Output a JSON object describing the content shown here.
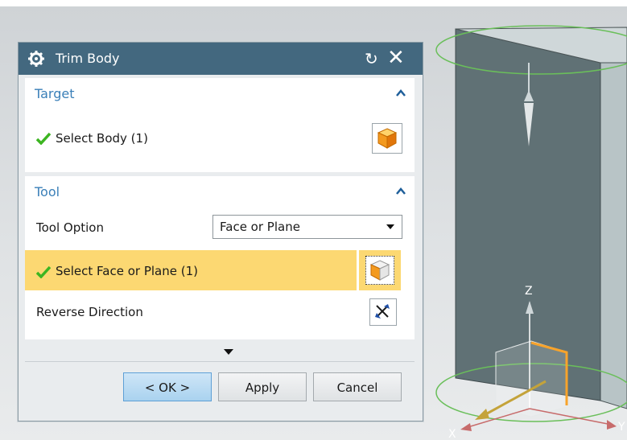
{
  "dialog": {
    "title": "Trim Body",
    "icons": {
      "title": "gear-icon",
      "reset": "reset-icon",
      "close": "close-icon"
    }
  },
  "target_group": {
    "header": "Target",
    "select_body_label": "Select Body (1)",
    "status_icon": "check-icon",
    "button_icon": "solid-cube-icon"
  },
  "tool_group": {
    "header": "Tool",
    "tool_option_label": "Tool Option",
    "tool_option_value": "Face or Plane",
    "select_face_label": "Select Face or Plane (1)",
    "reverse_direction_label": "Reverse Direction",
    "button_icons": [
      "face-cube-icon",
      "reverse-direction-icon"
    ]
  },
  "footer": {
    "ok_label": "< OK >",
    "apply_label": "Apply",
    "cancel_label": "Cancel"
  },
  "viewport": {
    "axis_labels": {
      "z": "Z",
      "x": "X",
      "y": "Y"
    }
  },
  "colors": {
    "titlebar": "#43687f",
    "group_header": "#3a7fb8",
    "highlight": "#fcd872",
    "check": "#3cb521",
    "body_face": "#5f6e72"
  }
}
